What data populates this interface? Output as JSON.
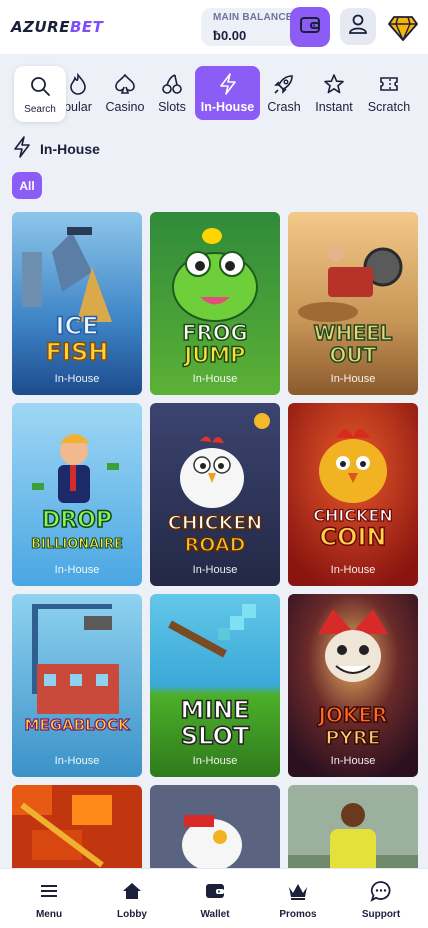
{
  "brand": {
    "part1": "AZURE",
    "part2": "BET"
  },
  "balance": {
    "label": "MAIN BALANCE",
    "value": "ƀ0.00"
  },
  "search": {
    "label": "Search"
  },
  "categories": [
    {
      "label": "pular",
      "icon": "flame-icon"
    },
    {
      "label": "Casino",
      "icon": "spade-icon"
    },
    {
      "label": "Slots",
      "icon": "cherries-icon"
    },
    {
      "label": "In-House",
      "icon": "lightning-icon",
      "active": true
    },
    {
      "label": "Crash",
      "icon": "rocket-icon"
    },
    {
      "label": "Instant",
      "icon": "star-icon"
    },
    {
      "label": "Scratch",
      "icon": "ticket-icon"
    }
  ],
  "section": {
    "title": "In-House",
    "filter": "All"
  },
  "games": [
    {
      "title1": "ICE",
      "title2": "FISH",
      "tag": "In-House"
    },
    {
      "title1": "FROG",
      "title2": "JUMP",
      "tag": "In-House"
    },
    {
      "title1": "WHEEL",
      "title2": "OUT",
      "tag": "In-House"
    },
    {
      "title1": "DROP",
      "title2": "BILLIONAIRE",
      "tag": "In-House"
    },
    {
      "title1": "CHICKEN",
      "title2": "ROAD",
      "tag": "In-House"
    },
    {
      "title1": "CHICKEN",
      "title2": "COIN",
      "tag": "In-House"
    },
    {
      "title1": "MEGABLOCK",
      "title2": "",
      "tag": "In-House"
    },
    {
      "title1": "MINE",
      "title2": "SLOT",
      "tag": "In-House"
    },
    {
      "title1": "JOKER",
      "title2": "PYRE",
      "tag": "In-House"
    }
  ],
  "bottom_nav": [
    {
      "label": "Menu",
      "icon": "menu-icon"
    },
    {
      "label": "Lobby",
      "icon": "home-icon"
    },
    {
      "label": "Wallet",
      "icon": "wallet-icon"
    },
    {
      "label": "Promos",
      "icon": "crown-icon"
    },
    {
      "label": "Support",
      "icon": "chat-icon"
    }
  ],
  "colors": {
    "accent": "#8b5cf6",
    "background": "#eef0f8",
    "text": "#1b1f3a"
  }
}
